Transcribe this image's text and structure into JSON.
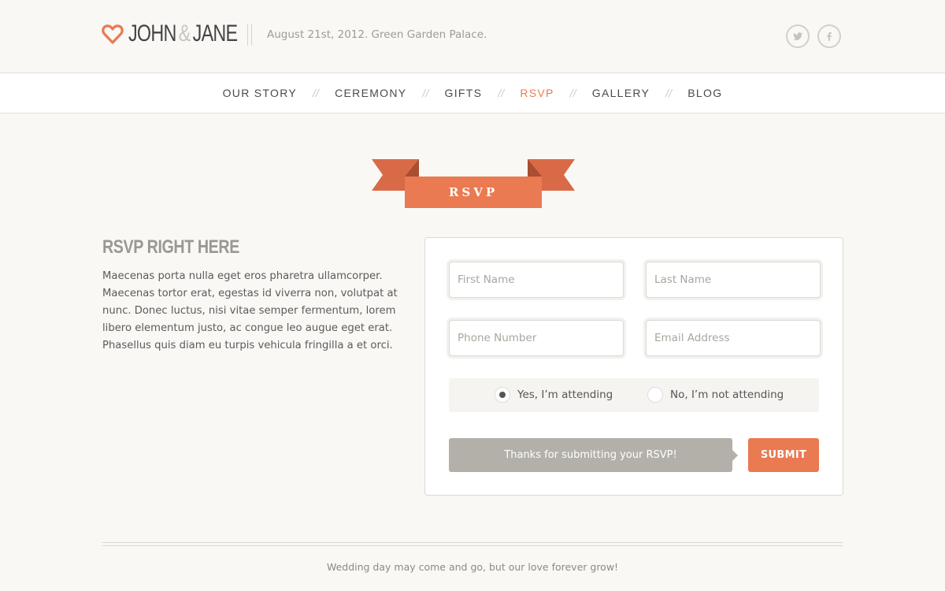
{
  "brand": {
    "name_left": "JOHN",
    "ampersand": "&",
    "name_right": "JANE",
    "icon": "heart-icon",
    "accent_color": "#ea7a52"
  },
  "header": {
    "tagline": "August 21st, 2012. Green Garden Palace.",
    "social": [
      {
        "icon": "twitter-icon"
      },
      {
        "icon": "facebook-icon"
      }
    ]
  },
  "nav": {
    "separator": "//",
    "items": [
      {
        "label": "OUR STORY"
      },
      {
        "label": "CEREMONY"
      },
      {
        "label": "GIFTS"
      },
      {
        "label": "RSVP",
        "active": true
      },
      {
        "label": "GALLERY"
      },
      {
        "label": "BLOG"
      }
    ]
  },
  "ribbon": {
    "label": "RSVP"
  },
  "intro": {
    "heading": "RSVP RIGHT HERE",
    "body": "Maecenas porta nulla eget eros pharetra ullamcorper. Maecenas tortor erat, egestas id viverra non, volutpat at nunc. Donec luctus, nisi vitae semper fermentum, lorem libero elementum justo, ac congue leo augue eget erat. Phasellus quis diam eu turpis vehicula fringilla a et orci."
  },
  "form": {
    "first_name": {
      "placeholder": "First Name",
      "value": ""
    },
    "last_name": {
      "placeholder": "Last Name",
      "value": ""
    },
    "phone": {
      "placeholder": "Phone Number",
      "value": ""
    },
    "email": {
      "placeholder": "Email Address",
      "value": ""
    },
    "attending_yes": {
      "label": "Yes, I’m attending",
      "checked": true
    },
    "attending_no": {
      "label": "No, I’m not attending",
      "checked": false
    },
    "status_message": "Thanks for submitting your RSVP!",
    "submit_label": "SUBMIT"
  },
  "footer": {
    "text": "Wedding day may come and go, but our love forever grow!"
  }
}
